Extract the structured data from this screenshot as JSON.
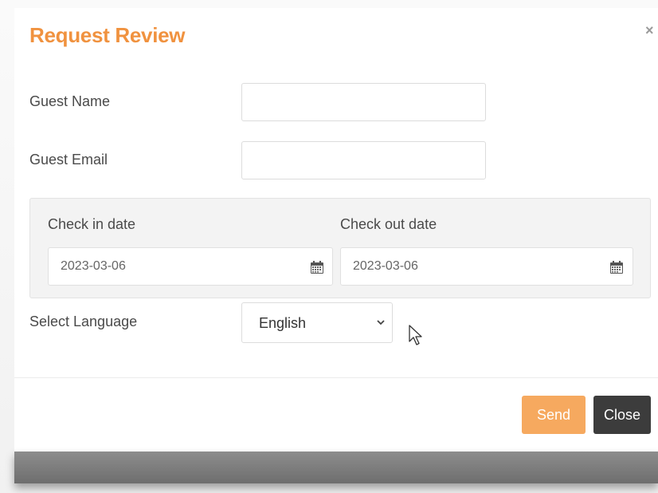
{
  "modal": {
    "title": "Request Review",
    "close_icon": "×"
  },
  "form": {
    "guest_name_label": "Guest Name",
    "guest_name_value": "",
    "guest_email_label": "Guest Email",
    "guest_email_value": "",
    "check_in_label": "Check in date",
    "check_in_value": "2023-03-06",
    "check_out_label": "Check out date",
    "check_out_value": "2023-03-06",
    "language_label": "Select Language",
    "language_value": "English"
  },
  "buttons": {
    "send_label": "Send",
    "close_label": "Close"
  },
  "colors": {
    "title": "#f0923f",
    "send": "#f6a95f",
    "close": "#3c3c3c"
  },
  "icons": [
    "close-icon",
    "calendar-icon",
    "chevron-down-icon",
    "mouse-pointer-icon"
  ]
}
